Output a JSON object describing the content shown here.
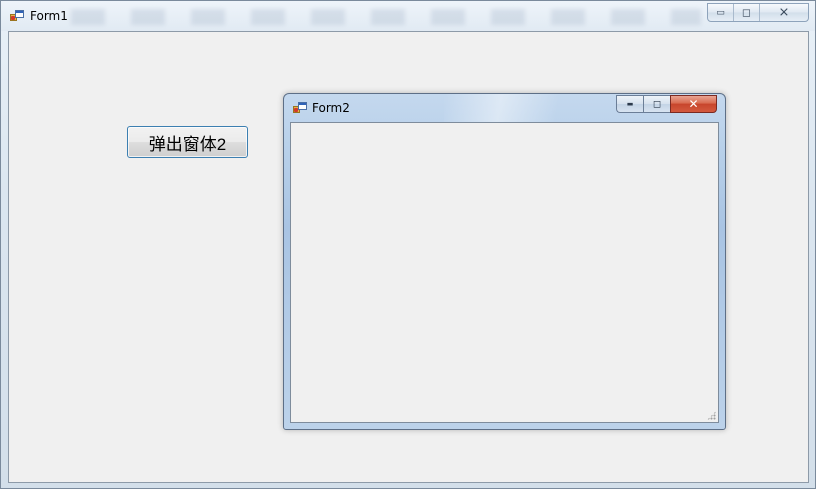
{
  "form1": {
    "title": "Form1",
    "caption_buttons": {
      "minimize": "▭",
      "restore": "◻",
      "close": "⨯"
    },
    "icon": "form-app-icon",
    "button": {
      "label": "弹出窗体2"
    }
  },
  "form2": {
    "title": "Form2",
    "icon": "form-app-icon",
    "caption_buttons": {
      "minimize": "▬",
      "restore": "◻",
      "close": "✕"
    }
  },
  "colors": {
    "client_bg": "#f0f0f0",
    "button_border": "#3c7fb1",
    "close_button": "#c7452c",
    "aero_title": "#b9d1ea"
  }
}
